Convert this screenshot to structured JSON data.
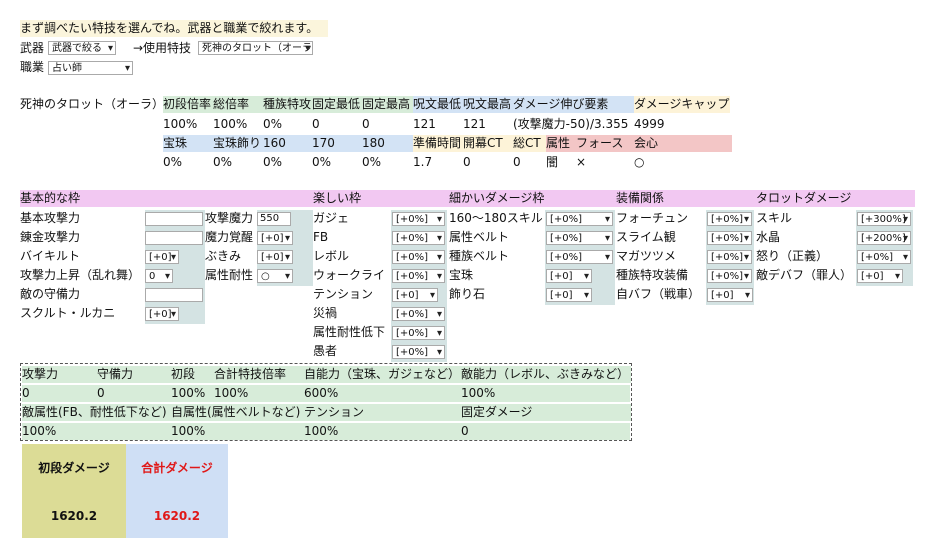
{
  "intro": "まず調べたい特技を選んでね。武器と職業で絞れます。",
  "selectors": {
    "weapon_label": "武器",
    "weapon_value": "武器で絞る",
    "arrow": "→使用特技",
    "skill_value": "死神のタロット（オーラ）",
    "job_label": "職業",
    "job_value": "占い師"
  },
  "skill_table": {
    "name": "死神のタロット（オーラ）",
    "row1_headers": [
      "初段倍率",
      "総倍率",
      "種族特攻",
      "固定最低",
      "固定最高",
      "呪文最低",
      "呪文最高",
      "ダメージ伸び要素",
      "ダメージキャップ"
    ],
    "row1_values": [
      "100%",
      "100%",
      "0%",
      "0",
      "0",
      "121",
      "121",
      "(攻撃魔力-50)/3.355",
      "4999"
    ],
    "row2_headers": [
      "宝珠",
      "宝珠飾り",
      "160",
      "170",
      "180",
      "準備時間",
      "開幕CT",
      "総CT",
      "属性",
      "フォース",
      "会心"
    ],
    "row2_values": [
      "0%",
      "0%",
      "0%",
      "0%",
      "0%",
      "1.7",
      "0",
      "0",
      "闇",
      "×",
      "○"
    ]
  },
  "sections": {
    "basic": {
      "header": "基本的な枠",
      "rows": [
        {
          "label": "基本攻撃力",
          "value": ""
        },
        {
          "label": "錬金攻撃力",
          "value": ""
        },
        {
          "label": "バイキルト",
          "value": "[+0]"
        },
        {
          "label": "攻撃力上昇（乱れ舞）",
          "value": "0"
        },
        {
          "label": "敵の守備力",
          "value": ""
        },
        {
          "label": "スクルト・ルカニ",
          "value": "[+0]"
        }
      ],
      "rows2": [
        {
          "label": "攻撃魔力",
          "value": "550"
        },
        {
          "label": "魔力覚醒",
          "value": "[+0]"
        },
        {
          "label": "ぶきみ",
          "value": "[+0]"
        },
        {
          "label": "属性耐性",
          "value": "○"
        }
      ]
    },
    "fun": {
      "header": "楽しい枠",
      "rows": [
        {
          "label": "ガジェ",
          "value": "[+0%]"
        },
        {
          "label": "FB",
          "value": "[+0%]"
        },
        {
          "label": "レボル",
          "value": "[+0%]"
        },
        {
          "label": "ウォークライ",
          "value": "[+0%]"
        },
        {
          "label": "テンション",
          "value": "[+0]"
        },
        {
          "label": "災禍",
          "value": "[+0%]"
        },
        {
          "label": "属性耐性低下",
          "value": "[+0%]"
        },
        {
          "label": "愚者",
          "value": "[+0%]"
        }
      ]
    },
    "detail": {
      "header": "細かいダメージ枠",
      "rows": [
        {
          "label": "160～180スキル",
          "value": "[+0%]"
        },
        {
          "label": "属性ベルト",
          "value": "[+0%]"
        },
        {
          "label": "種族ベルト",
          "value": "[+0%]"
        },
        {
          "label": "宝珠",
          "value": "[+0]"
        },
        {
          "label": "飾り石",
          "value": "[+0]"
        }
      ]
    },
    "equip": {
      "header": "装備関係",
      "rows": [
        {
          "label": "フォーチュン",
          "value": "[+0%]"
        },
        {
          "label": "スライム観",
          "value": "[+0%]"
        },
        {
          "label": "マガツツメ",
          "value": "[+0%]"
        },
        {
          "label": "種族特攻装備",
          "value": "[+0%]"
        },
        {
          "label": "自バフ（戦車）",
          "value": "[+0]"
        }
      ]
    },
    "tarot": {
      "header": "タロットダメージ",
      "rows": [
        {
          "label": "スキル",
          "value": "[+300%]"
        },
        {
          "label": "水晶",
          "value": "[+200%]"
        },
        {
          "label": "怒り（正義）",
          "value": "[+0%]"
        },
        {
          "label": "敵デバフ（罪人）",
          "value": "[+0]"
        }
      ]
    }
  },
  "summary": {
    "row1_headers": [
      "攻撃力",
      "守備力",
      "初段",
      "合計特技倍率",
      "自能力（宝珠、ガジェなど）",
      "敵能力（レボル、ぶきみなど）"
    ],
    "row1_values": [
      "0",
      "0",
      "100%",
      "100%",
      "600%",
      "100%"
    ],
    "row2_headers": [
      "敵属性(FB、耐性低下など)",
      "自属性(属性ベルトなど)",
      "テンション",
      "固定ダメージ"
    ],
    "row2_values": [
      "100%",
      "100%",
      "100%",
      "0"
    ]
  },
  "result": {
    "first_label": "初段ダメージ",
    "total_label": "合計ダメージ",
    "first_value": "1620.2",
    "total_value": "1620.2"
  },
  "colors": {
    "green": "#d7ecd9",
    "blue": "#d3e3f5",
    "cream": "#fdf3d8",
    "pink": "#f3c6c6",
    "magenta": "#f2c8f2",
    "olive": "#dcdc96",
    "red_text": "#e01818"
  }
}
